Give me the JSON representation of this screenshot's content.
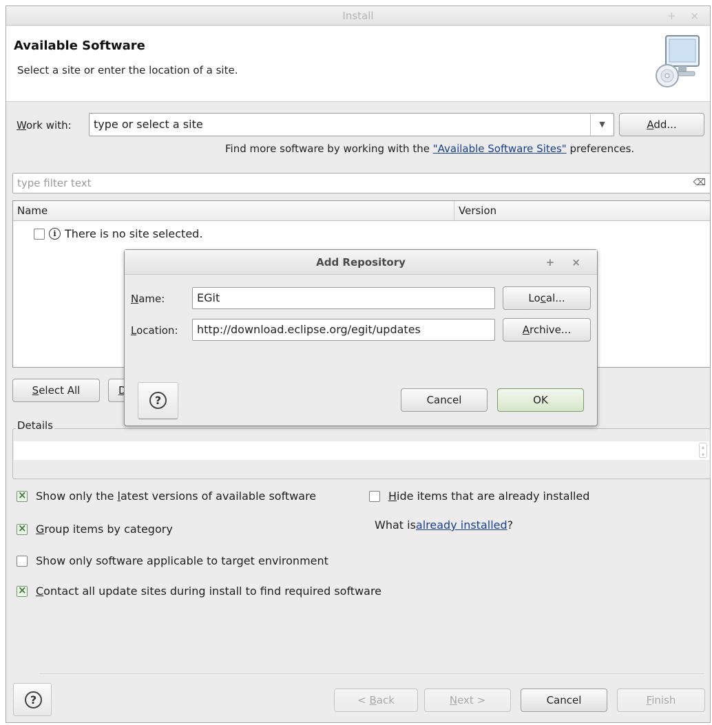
{
  "window": {
    "title": "Install",
    "controls": "+ ×"
  },
  "header": {
    "title": "Available Software",
    "description": "Select a site or enter the location of a site.",
    "icon": "computer-cd-icon"
  },
  "work_with": {
    "label_prefix": "",
    "label_mnemonic": "W",
    "label_rest": "ork with:",
    "value": "type or select a site",
    "dropdown_arrow": "▼",
    "add_button_mnemonic": "A",
    "add_button_rest": "dd..."
  },
  "find_more": {
    "text_before": "Find more software by working with the ",
    "link": "\"Available Software Sites\"",
    "text_after": " preferences."
  },
  "filter": {
    "placeholder": "type filter text",
    "clear_icon": "⌫"
  },
  "tree": {
    "columns": [
      "Name",
      "Version"
    ],
    "rows": [
      {
        "checked": false,
        "icon": "info-icon",
        "label": "There is no site selected."
      }
    ]
  },
  "selection_buttons": {
    "select_all_mnemonic": "S",
    "select_all_rest": "elect All",
    "deselect_all_partial": "D"
  },
  "details": {
    "label": "Details",
    "text": ""
  },
  "options": {
    "show_latest": {
      "checked": true,
      "before": "Show only the ",
      "mnemonic": "l",
      "after": "atest versions of available software"
    },
    "hide_installed": {
      "checked": false,
      "before": "",
      "mnemonic": "H",
      "after": "ide items that are already installed"
    },
    "group_by_category": {
      "checked": true,
      "before": "",
      "mnemonic": "G",
      "after": "roup items by category"
    },
    "what_is_before": "What is ",
    "what_is_link": "already installed",
    "what_is_after": "?",
    "applicable_target": {
      "checked": false,
      "label": "Show only software applicable to target environment"
    },
    "contact_sites": {
      "checked": true,
      "before": "",
      "mnemonic": "C",
      "after": "ontact all update sites during install to find required software"
    }
  },
  "footer": {
    "help": "?",
    "back": "< Back",
    "back_mnemonic": "B",
    "next": "Next >",
    "next_mnemonic": "N",
    "cancel": "Cancel",
    "finish": "Finish",
    "finish_mnemonic": "F"
  },
  "dialog": {
    "title": "Add Repository",
    "controls": "+ ×",
    "name_label_mnemonic": "N",
    "name_label_rest": "ame:",
    "name_value": "EGit",
    "location_label_mnemonic": "L",
    "location_label_rest": "ocation:",
    "location_value": "http://download.eclipse.org/egit/updates",
    "local_before": "Lo",
    "local_mnemonic": "c",
    "local_after": "al...",
    "archive_mnemonic": "A",
    "archive_rest": "rchive...",
    "help": "?",
    "cancel": "Cancel",
    "ok": "OK"
  }
}
